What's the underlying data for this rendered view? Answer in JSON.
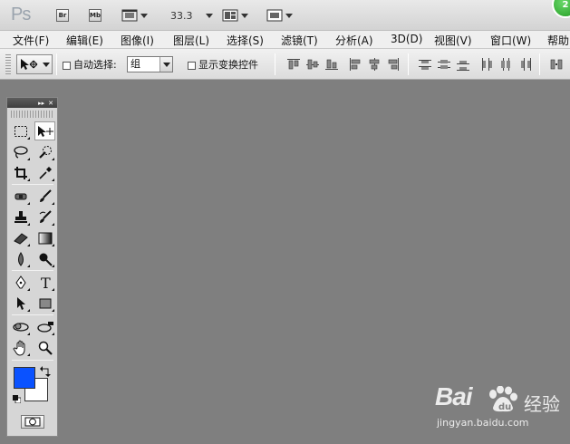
{
  "app": {
    "logo": "Ps",
    "bridge_label": "Br",
    "minibridge_label": "Mb",
    "zoom": "33.3",
    "badge": "2"
  },
  "menu": [
    "文件(F)",
    "编辑(E)",
    "图像(I)",
    "图层(L)",
    "选择(S)",
    "滤镜(T)",
    "分析(A)",
    "3D(D)",
    "视图(V)",
    "窗口(W)",
    "帮助"
  ],
  "options": {
    "auto_select_label": "自动选择:",
    "auto_select_value": "组",
    "show_transform_label": "显示变换控件"
  },
  "tools_panel": {
    "collapse_label": "▸▸",
    "close_label": "✕"
  },
  "colors": {
    "foreground": "#0a52ff",
    "background": "#ffffff",
    "canvas": "#7f7f7f"
  },
  "watermark": {
    "logo": "Bai",
    "logo_tail": "经验",
    "url": "jingyan.baidu.com"
  }
}
